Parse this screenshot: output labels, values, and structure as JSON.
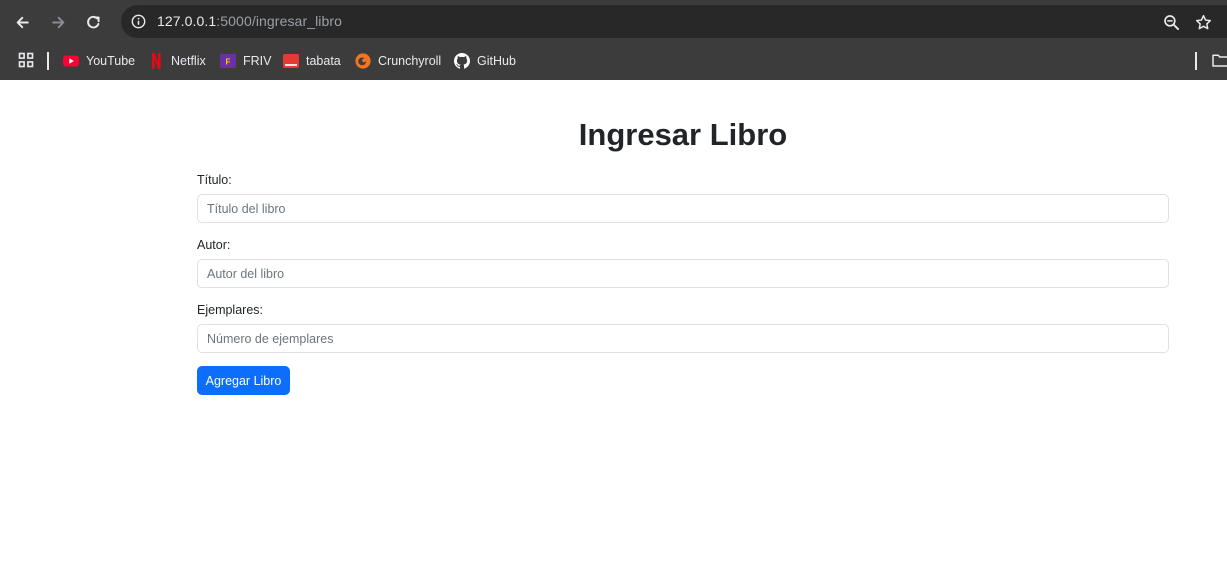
{
  "browser": {
    "url_host": "127.0.0.1",
    "url_path": ":5000/ingresar_libro",
    "icons": {
      "back": "arrow-left-icon",
      "forward": "arrow-right-icon",
      "reload": "reload-icon",
      "site_info": "info-icon",
      "zoom": "zoom-icon",
      "bookmark_star": "star-icon"
    },
    "bookmarks": [
      {
        "label": "YouTube",
        "icon": "youtube-icon"
      },
      {
        "label": "Netflix",
        "icon": "netflix-icon"
      },
      {
        "label": "FRIV",
        "icon": "friv-icon"
      },
      {
        "label": "tabata",
        "icon": "tabata-icon"
      },
      {
        "label": "Crunchyroll",
        "icon": "crunchyroll-icon"
      },
      {
        "label": "GitHub",
        "icon": "github-icon"
      }
    ],
    "colors": {
      "chrome_background": "#3c3c3c",
      "omnibox_background": "#282828",
      "text": "#e8eaed"
    }
  },
  "page": {
    "title": "Ingresar Libro",
    "form": {
      "titulo": {
        "label": "Título:",
        "placeholder": "Título del libro",
        "value": ""
      },
      "autor": {
        "label": "Autor:",
        "placeholder": "Autor del libro",
        "value": ""
      },
      "ejemplares": {
        "label": "Ejemplares:",
        "placeholder": "Número de ejemplares",
        "value": ""
      },
      "submit_label": "Agregar Libro"
    },
    "colors": {
      "primary": "#0d6efd",
      "text": "#212529",
      "border": "#dee2e6"
    }
  }
}
